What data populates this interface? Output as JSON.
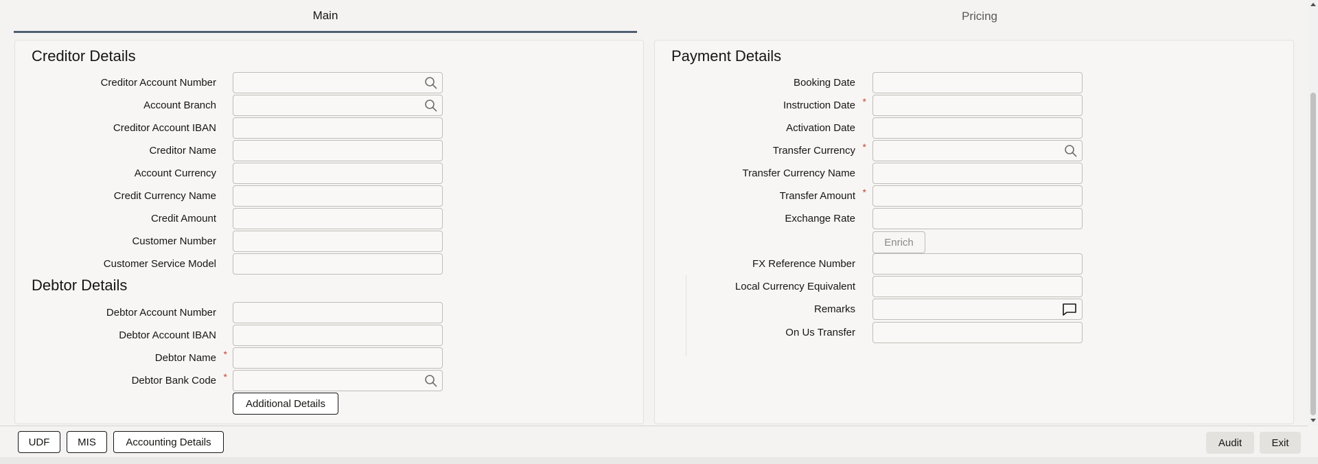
{
  "tabs": [
    {
      "label": "Main",
      "active": true
    },
    {
      "label": "Pricing",
      "active": false
    }
  ],
  "creditor": {
    "title": "Creditor Details",
    "fields": [
      {
        "label": "Creditor Account Number",
        "value": "",
        "icon": "search-icon"
      },
      {
        "label": "Account Branch",
        "value": "",
        "icon": "search-icon"
      },
      {
        "label": "Creditor Account IBAN",
        "value": ""
      },
      {
        "label": "Creditor Name",
        "value": ""
      },
      {
        "label": "Account Currency",
        "value": ""
      },
      {
        "label": "Credit Currency Name",
        "value": ""
      },
      {
        "label": "Credit Amount",
        "value": ""
      },
      {
        "label": "Customer Number",
        "value": ""
      },
      {
        "label": "Customer Service Model",
        "value": ""
      }
    ]
  },
  "debtor": {
    "title": "Debtor Details",
    "fields": [
      {
        "label": "Debtor Account Number",
        "value": ""
      },
      {
        "label": "Debtor Account IBAN",
        "value": ""
      },
      {
        "label": "Debtor Name",
        "value": "",
        "required": true
      },
      {
        "label": "Debtor Bank Code",
        "value": "",
        "required": true,
        "icon": "search-icon"
      }
    ],
    "additional_details_label": "Additional Details"
  },
  "payment": {
    "title": "Payment Details",
    "fields": [
      {
        "label": "Booking Date",
        "value": ""
      },
      {
        "label": "Instruction Date",
        "value": "",
        "required": true
      },
      {
        "label": "Activation Date",
        "value": ""
      },
      {
        "label": "Transfer Currency",
        "value": "",
        "required": true,
        "icon": "search-icon"
      },
      {
        "label": "Transfer Currency Name",
        "value": ""
      },
      {
        "label": "Transfer Amount",
        "value": "",
        "required": true
      },
      {
        "label": "Exchange Rate",
        "value": ""
      },
      {
        "label": "FX Reference Number",
        "value": ""
      },
      {
        "label": "Local Currency Equivalent",
        "value": ""
      },
      {
        "label": "Remarks",
        "value": "",
        "icon": "comment-icon"
      },
      {
        "label": "On Us Transfer",
        "value": ""
      }
    ],
    "enrich_label": "Enrich"
  },
  "footer": {
    "udf_label": "UDF",
    "mis_label": "MIS",
    "accounting_label": "Accounting Details",
    "audit_label": "Audit",
    "exit_label": "Exit"
  },
  "required_marker": "*",
  "colors": {
    "required": "#c74634",
    "tab_underline": "#4f5d73"
  }
}
